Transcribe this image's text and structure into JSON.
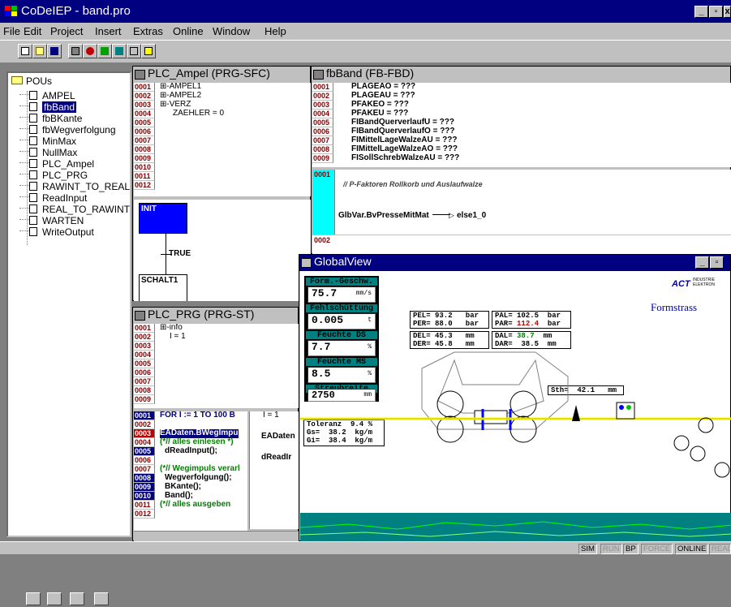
{
  "app": {
    "title": "CoDeIEP - band.pro"
  },
  "menu": [
    "File",
    "Edit",
    "Project",
    "Insert",
    "Extras",
    "Online",
    "Window",
    "Help"
  ],
  "pous": {
    "root": "POUs",
    "items": [
      "AMPEL",
      "fbBand",
      "fbBKante",
      "fbWegverfolgung",
      "MinMax",
      "NullMax",
      "PLC_Ampel",
      "PLC_PRG",
      "RAWINT_TO_REAL",
      "ReadInput",
      "REAL_TO_RAWINT",
      "WARTEN",
      "WriteOutput"
    ],
    "selected": "fbBand"
  },
  "ampel": {
    "title": "PLC_Ampel (PRG-SFC)",
    "lines": [
      "0001",
      "0002",
      "0003",
      "0004",
      "0005",
      "0006",
      "0007",
      "0008",
      "0009",
      "0010",
      "0011",
      "0012"
    ],
    "code": [
      "⊞-AMPEL1",
      "⊞-AMPEL2",
      "⊞-VERZ",
      "ZAEHLER = 0"
    ],
    "init": "INIT",
    "true": "TRUE",
    "schalt": "SCHALT1"
  },
  "band": {
    "title": "fbBand (FB-FBD)",
    "lines": [
      "0001",
      "0002",
      "0003",
      "0004",
      "0005",
      "0006",
      "0007",
      "0008",
      "0009"
    ],
    "code": [
      "PLAGEAO = ???",
      "PLAGEAU = ???",
      "PFAKEO = ???",
      "PFAKEU = ???",
      "FIBandQuerverlaufU = ???",
      "FIBandQuerverlaufO = ???",
      "FIMittelLageWalzeAU = ???",
      "FIMittelLageWalzeAO = ???",
      "FISollSchrebWalzeAU = ???"
    ],
    "net1": "0001",
    "comment": "// P-Faktoren Rollkorb und Auslaufwalze",
    "assign": "GlbVar.BvPresseMitMat",
    "target": "else1_0",
    "net2": "0002"
  },
  "prg": {
    "title": "PLC_PRG (PRG-ST)",
    "lines": [
      "0001",
      "0002",
      "0003",
      "0004",
      "0005",
      "0006",
      "0007",
      "0008",
      "0009"
    ],
    "code": [
      "⊞-info",
      "I = 1"
    ],
    "lines2": [
      "0001",
      "0002",
      "0003",
      "0004",
      "0005",
      "0006",
      "0007",
      "0008",
      "0009",
      "0010",
      "0011",
      "0012"
    ],
    "code2": [
      "FOR I := 1 TO 100 B",
      "",
      "EADaten.BWegImpu",
      "(*// alles einlesen *)",
      "dReadInput();",
      "",
      "(*// Wegimpuls verarl",
      "Wegverfolgung();",
      "BKante();",
      "Band();",
      "(*// alles ausgeben",
      ""
    ],
    "col2": [
      "I = 1",
      "",
      "EADaten",
      "",
      "dReadIr"
    ]
  },
  "global": {
    "title": "GlobalView",
    "form_label": "Form.-Geschw.",
    "form_val": "75.7",
    "form_unit": "mm/s",
    "fehl_label": "Fehlschüttung",
    "fehl_val": "0.005",
    "fehl_unit": "t",
    "feuchte_ds_label": "Feuchte DS",
    "feuchte_ds_val": "7.7",
    "feuchte_ds_unit": "%",
    "feuchte_ms_label": "Feuchte MS",
    "feuchte_ms_val": "8.5",
    "feuchte_ms_unit": "%",
    "streu_label": "Streubreite",
    "streu_val": "2750",
    "streu_unit": "mm",
    "brand": "ACT",
    "brand_sub": "INDUSTRIE ELEKTRON",
    "formstrasse": "Formstrass",
    "pel": "PEL= 93.2   bar",
    "per": "PER= 88.0   bar",
    "pal": "PAL= 102.5  bar",
    "par_lbl": "PAR=",
    "par_val": "112.4",
    "par_unit": "bar",
    "del": "DEL= 45.3   mm",
    "der": "DER= 45.8   mm",
    "dal_lbl": "DAL=",
    "dal_val": "38.7",
    "dal_unit": "mm",
    "dar": "DAR=  38.5  mm",
    "sth": "Sth=  42.1   mm",
    "tol": "Toleranz  9.4 %",
    "gs": "Gs=  38.2  kg/m",
    "gi": "Gi=  38.4  kg/m"
  },
  "status": [
    "SIM",
    "RUN",
    "BP",
    "FORCE",
    "ONLINE",
    "READ"
  ]
}
